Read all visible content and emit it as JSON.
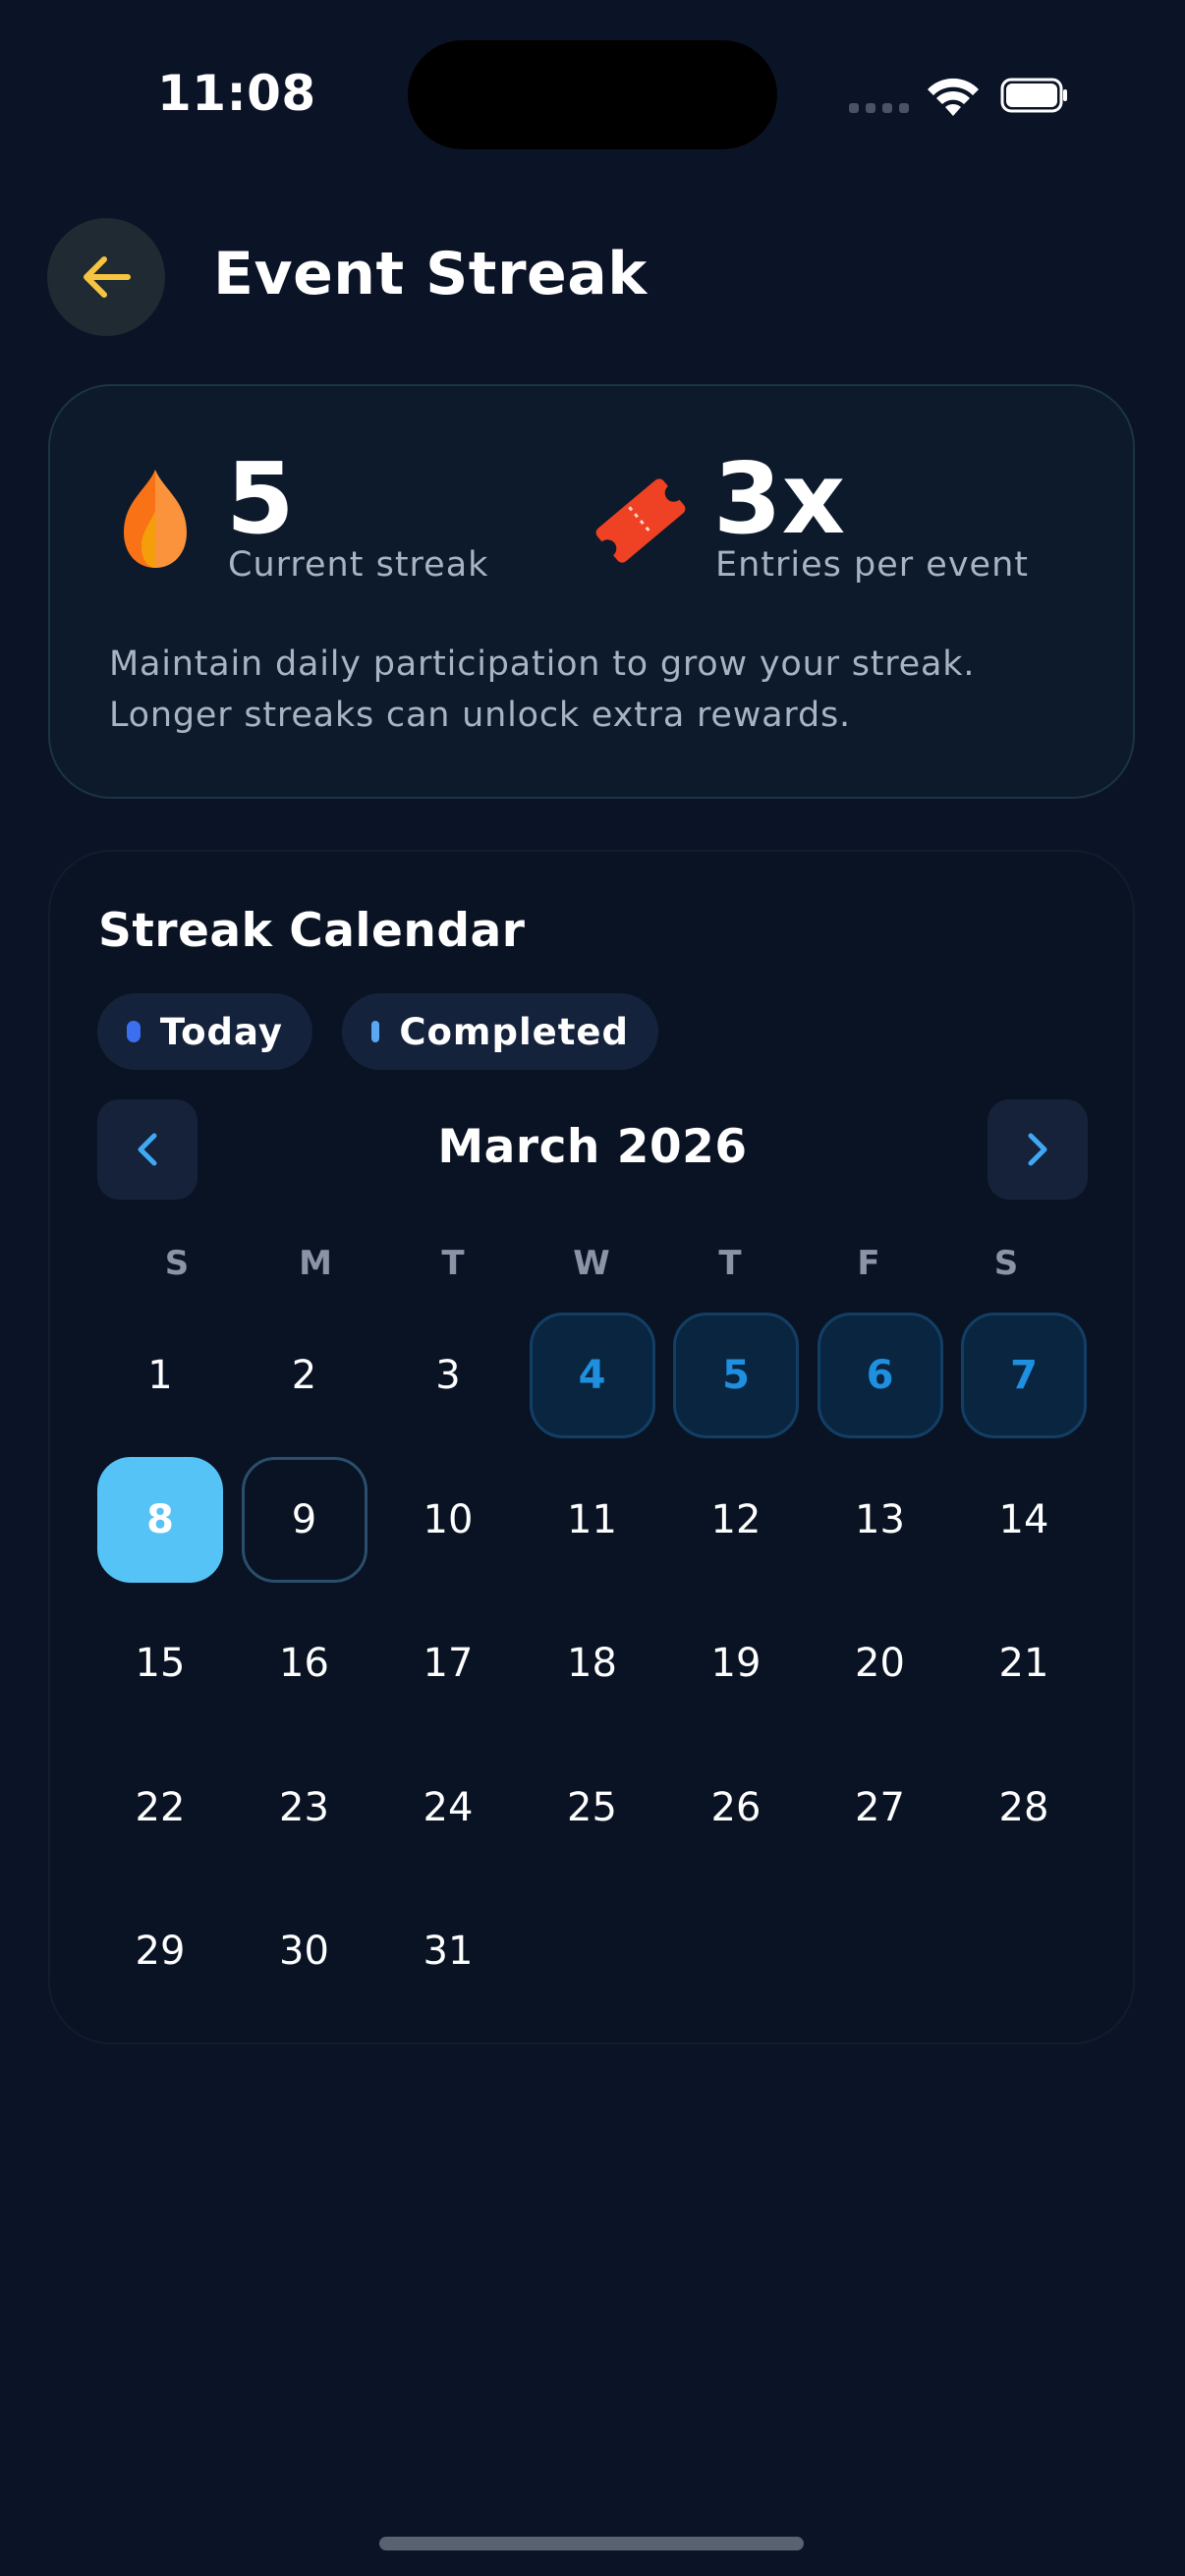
{
  "status_bar": {
    "time": "11:08"
  },
  "header": {
    "title": "Event Streak",
    "back_icon": "arrow-left-icon"
  },
  "stats": {
    "current_streak_value": "5",
    "current_streak_label": "Current streak",
    "entries_value": "3x",
    "entries_label": "Entries per event",
    "description_line1": "Maintain daily participation to grow your streak.",
    "description_line2": "Longer streaks can unlock extra rewards.",
    "streak_icon": "flame-icon",
    "entries_icon": "ticket-icon"
  },
  "calendar": {
    "title": "Streak Calendar",
    "legend": [
      {
        "label": "Today",
        "color": "#3b6ff0"
      },
      {
        "label": "Completed",
        "color": "#5aa8f5"
      }
    ],
    "month": "March 2026",
    "weekdays": [
      "S",
      "M",
      "T",
      "W",
      "T",
      "F",
      "S"
    ],
    "days": [
      "1",
      "2",
      "3",
      "4",
      "5",
      "6",
      "7",
      "8",
      "9",
      "10",
      "11",
      "12",
      "13",
      "14",
      "15",
      "16",
      "17",
      "18",
      "19",
      "20",
      "21",
      "22",
      "23",
      "24",
      "25",
      "26",
      "27",
      "28",
      "29",
      "30",
      "31"
    ],
    "completed_days": [
      4,
      5,
      6,
      7
    ],
    "today": 8,
    "outlined_day": 9
  },
  "colors": {
    "background": "#0b1426",
    "accent_today": "#56c3f6",
    "completed_text": "#1f8fe0",
    "back_arrow": "#f5c542"
  }
}
